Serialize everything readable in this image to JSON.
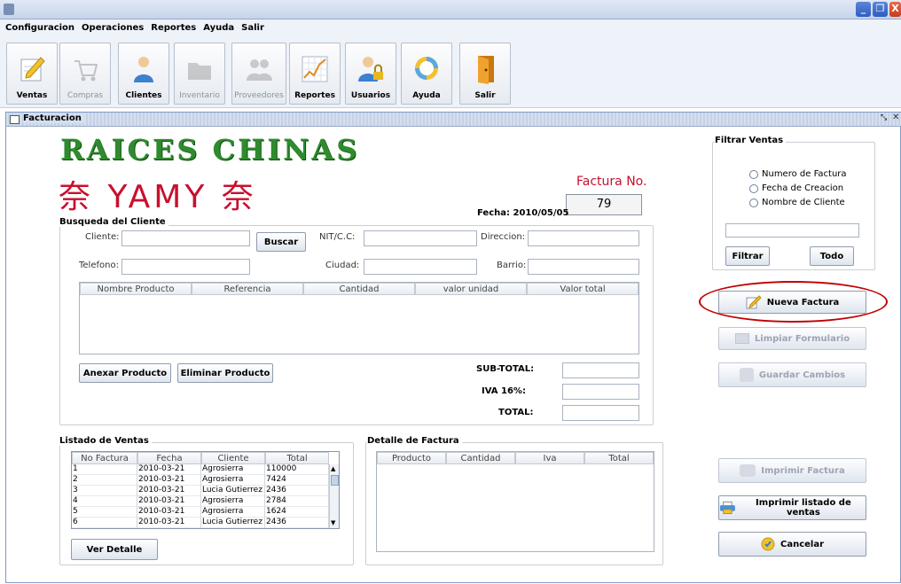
{
  "menu": [
    "Configuracion",
    "Operaciones",
    "Reportes",
    "Ayuda",
    "Salir"
  ],
  "window_buttons": {
    "minimize": "_",
    "maximize": "❐",
    "close": "X"
  },
  "toolbar": [
    {
      "label": "Ventas",
      "enabled": true,
      "icon": "pencil-paper-icon"
    },
    {
      "label": "Compras",
      "enabled": false,
      "icon": "cart-icon"
    },
    {
      "label": "Clientes",
      "enabled": true,
      "icon": "person-icon"
    },
    {
      "label": "Inventario",
      "enabled": false,
      "icon": "folder-icon"
    },
    {
      "label": "Proveedores",
      "enabled": false,
      "icon": "users-icon"
    },
    {
      "label": "Reportes",
      "enabled": true,
      "icon": "chart-icon"
    },
    {
      "label": "Usuarios",
      "enabled": true,
      "icon": "user-lock-icon"
    },
    {
      "label": "Ayuda",
      "enabled": true,
      "icon": "lifebuoy-icon"
    },
    {
      "label": "Salir",
      "enabled": true,
      "icon": "door-icon"
    }
  ],
  "frame": {
    "title": "Facturacion"
  },
  "logo": {
    "line1": "RAICES CHINAS",
    "line2": "奈 YAMY 奈"
  },
  "factura": {
    "label": "Factura No.",
    "number": "79",
    "fecha": "Fecha: 2010/05/05"
  },
  "cliente_section": {
    "title": "Busqueda del Cliente",
    "cliente_label": "Cliente:",
    "buscar": "Buscar",
    "nit_label": "NIT/C.C:",
    "direccion_label": "Direccion:",
    "telefono_label": "Telefono:",
    "ciudad_label": "Ciudad:",
    "barrio_label": "Barrio:"
  },
  "product_table": {
    "headers": [
      "Nombre Producto",
      "Referencia",
      "Cantidad",
      "valor unidad",
      "Valor total"
    ]
  },
  "actions": {
    "anexar": "Anexar Producto",
    "eliminar": "Eliminar Producto"
  },
  "totals": {
    "subtotal": "SUB-TOTAL:",
    "iva": "IVA 16%:",
    "total": "TOTAL:"
  },
  "filtrar": {
    "title": "Filtrar Ventas",
    "options": [
      "Numero de Factura",
      "Fecha de Creacion",
      "Nombre de Cliente"
    ],
    "filtrar": "Filtrar",
    "todo": "Todo"
  },
  "side_buttons": {
    "nueva": "Nueva Factura",
    "limpiar": "Limpiar Formulario",
    "guardar": "Guardar Cambios",
    "imprimir": "Imprimir Factura",
    "imprimir_listado": "Imprimir listado de ventas",
    "cancelar": "Cancelar"
  },
  "listado": {
    "title": "Listado de Ventas",
    "headers": [
      "No Factura",
      "Fecha",
      "Cliente",
      "Total"
    ],
    "rows": [
      [
        "1",
        "2010-03-21",
        "Agrosierra",
        "110000"
      ],
      [
        "2",
        "2010-03-21",
        "Agrosierra",
        "7424"
      ],
      [
        "3",
        "2010-03-21",
        "Lucia Gutierrez",
        "2436"
      ],
      [
        "4",
        "2010-03-21",
        "Agrosierra",
        "2784"
      ],
      [
        "5",
        "2010-03-21",
        "Agrosierra",
        "1624"
      ],
      [
        "6",
        "2010-03-21",
        "Lucia Gutierrez",
        "2436"
      ]
    ],
    "ver_detalle": "Ver Detalle"
  },
  "detalle": {
    "title": "Detalle de Factura",
    "headers": [
      "Producto",
      "Cantidad",
      "Iva",
      "Total"
    ]
  },
  "colors": {
    "accent_red": "#c8102e",
    "logo_green": "#2e8b2e",
    "highlight_ellipse": "#c00000"
  }
}
